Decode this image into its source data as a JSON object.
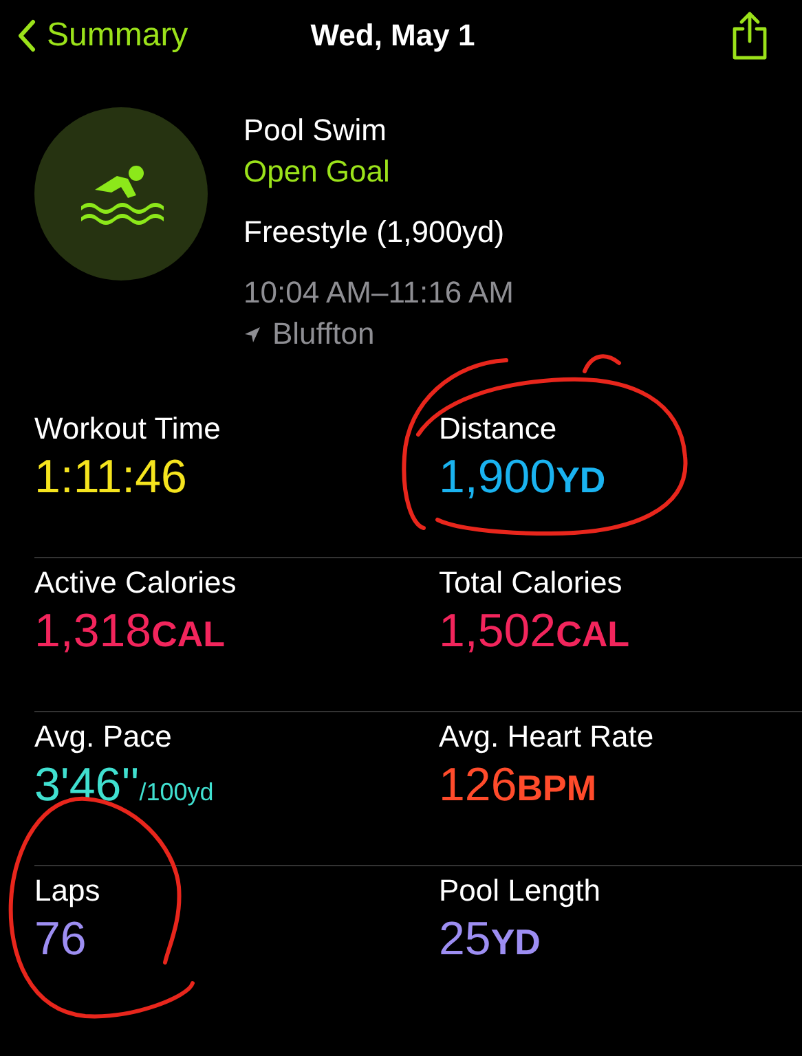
{
  "nav": {
    "back": "Summary",
    "title": "Wed, May 1"
  },
  "workout": {
    "type": "Pool Swim",
    "goal": "Open Goal",
    "stroke": "Freestyle (1,900yd)",
    "time": "10:04 AM–11:16 AM",
    "location": "Bluffton"
  },
  "stats": [
    {
      "label": "Workout Time",
      "value": "1:11:46",
      "color": "#f5e41e"
    },
    {
      "label": "Distance",
      "value": "1,900",
      "unit": "YD",
      "kind": "caps",
      "color": "#1ab3f0"
    },
    {
      "label": "Active Calories",
      "value": "1,318",
      "unit": "CAL",
      "kind": "caps",
      "color": "#f2255c"
    },
    {
      "label": "Total Calories",
      "value": "1,502",
      "unit": "CAL",
      "kind": "caps",
      "color": "#f2255c"
    },
    {
      "label": "Avg. Pace",
      "value": "3'46''",
      "unit": "/100yd",
      "kind": "small",
      "color": "#40e0d0"
    },
    {
      "label": "Avg. Heart Rate",
      "value": "126",
      "unit": "BPM",
      "kind": "caps",
      "color": "#ff4b2b"
    },
    {
      "label": "Laps",
      "value": "76",
      "color": "#9d8ef2"
    },
    {
      "label": "Pool Length",
      "value": "25",
      "unit": "YD",
      "kind": "caps",
      "color": "#9d8ef2"
    }
  ]
}
